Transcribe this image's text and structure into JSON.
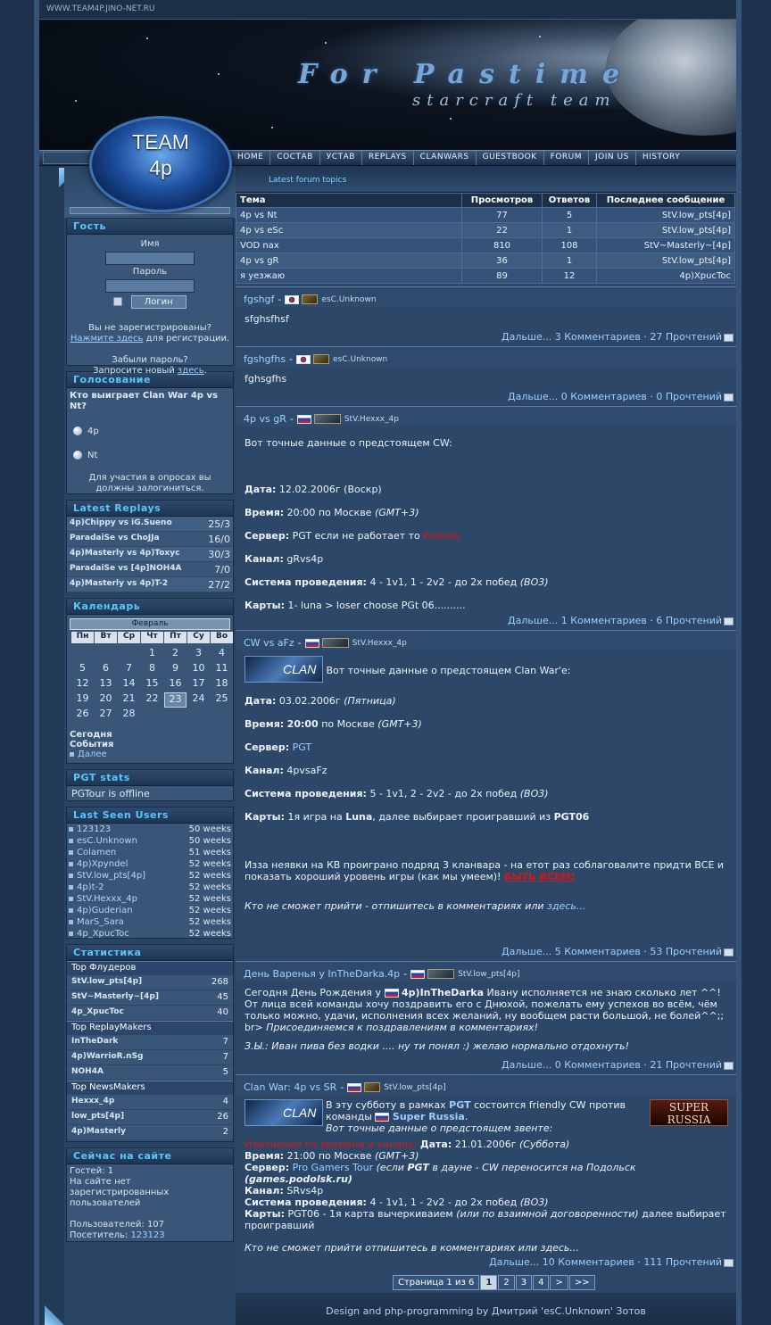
{
  "topbar_url": "WWW.TEAM4P.JINO-NET.RU",
  "header": {
    "title": "For Pastime",
    "subtitle": "starcraft team",
    "logo_line1": "TEAM",
    "logo_line2": "4p"
  },
  "nav": [
    "HOME",
    "СОСТАВ",
    "УСТАВ",
    "REPLAYS",
    "CLANWARS",
    "GUESTBOOK",
    "FORUM",
    "JOIN US",
    "HISTORY"
  ],
  "guest": {
    "title": "Гость",
    "name_label": "Имя",
    "password_label": "Пароль",
    "login_button": "Логин",
    "not_registered": "Вы не зарегистрированы?",
    "register_link": "Нажмите здесь",
    "register_suffix": "для регистрации.",
    "forgot": "Забыли пароль?",
    "request_prefix": "Запросите новый",
    "request_link": "здесь",
    "request_suffix": "."
  },
  "poll": {
    "title": "Голосование",
    "question": "Кто выиграет Clan War 4p vs Nt?",
    "options": [
      "4p",
      "Nt"
    ],
    "note": "Для участия в опросах вы должны залогиниться."
  },
  "replays": {
    "title": "Latest Replays",
    "items": [
      {
        "name": "4p)Chippy vs iG.Sueno",
        "score": "25/3"
      },
      {
        "name": "ParadaiSe vs ChoJJa",
        "score": "16/0"
      },
      {
        "name": "4p)Masterly vs 4p)Toxyc",
        "score": "30/3"
      },
      {
        "name": "ParadaiSe vs [4p]NOH4A",
        "score": "7/0"
      },
      {
        "name": "4p)Masterly vs 4p)T-2",
        "score": "27/2"
      }
    ]
  },
  "calendar": {
    "title": "Календарь",
    "month": "Февраль",
    "weekdays": [
      "Пн",
      "Вт",
      "Ср",
      "Чт",
      "Пт",
      "Су",
      "Во"
    ],
    "days": [
      "",
      "",
      "",
      "1",
      "2",
      "3",
      "4",
      "5",
      "6",
      "7",
      "8",
      "9",
      "10",
      "11",
      "12",
      "13",
      "14",
      "15",
      "16",
      "17",
      "18",
      "19",
      "20",
      "21",
      "22",
      "23",
      "24",
      "25",
      "26",
      "27",
      "28",
      "",
      "",
      "",
      ""
    ],
    "today": "23",
    "today_label": "Сегодня",
    "events_label": "События",
    "more_link": "Далее"
  },
  "pgt": {
    "title": "PGT stats",
    "status": "PGTour is offline"
  },
  "last_seen": {
    "title": "Last Seen Users",
    "items": [
      {
        "user": "123123",
        "ago": "50 weeks"
      },
      {
        "user": "esC.Unknown",
        "ago": "50 weeks"
      },
      {
        "user": "Colamen",
        "ago": "51 weeks"
      },
      {
        "user": "4p)Xpyndel",
        "ago": "52 weeks"
      },
      {
        "user": "StV.low_pts[4p]",
        "ago": "52 weeks"
      },
      {
        "user": "4p)t-2",
        "ago": "52 weeks"
      },
      {
        "user": "StV.Hexxx_4p",
        "ago": "52 weeks"
      },
      {
        "user": "4p)Guderian",
        "ago": "52 weeks"
      },
      {
        "user": "MarS_Sara",
        "ago": "52 weeks"
      },
      {
        "user": "4p_XpucToc",
        "ago": "52 weeks"
      }
    ]
  },
  "stats": {
    "title": "Статистика",
    "flooders_title": "Top Флудеров",
    "flooders": [
      {
        "name": "StV.low_pts[4p]",
        "value": "268"
      },
      {
        "name": "StV~Masterly~[4p]",
        "value": "45"
      },
      {
        "name": "4p_XpucToc",
        "value": "40"
      }
    ],
    "replaymakers_title": "Top ReplayMakers",
    "replaymakers": [
      {
        "name": "InTheDark",
        "value": "7"
      },
      {
        "name": "4p)WarrioR.nSg",
        "value": "7"
      },
      {
        "name": "NOH4A",
        "value": "5"
      }
    ],
    "newsmakers_title": "Top NewsMakers",
    "newsmakers": [
      {
        "name": "Hexxx_4p",
        "value": "4"
      },
      {
        "name": "low_pts[4p]",
        "value": "26"
      },
      {
        "name": "4p)Masterly",
        "value": "2"
      }
    ]
  },
  "online": {
    "title": "Сейчас на сайте",
    "guests": "Гостей: 1",
    "members": "На сайте нет зарегистрированных пользователей",
    "users": "Пользователей: 107",
    "visitor_prefix": "Посетитель:",
    "visitor_link": "123123"
  },
  "forum": {
    "title": "Latest forum topics",
    "headers": [
      "Тема",
      "Просмотров",
      "Ответов",
      "Последнее сообщение"
    ],
    "rows": [
      {
        "topic": "4p vs Nt",
        "views": "77",
        "replies": "5",
        "last": "StV.low_pts[4p]"
      },
      {
        "topic": "4p vs eSc",
        "views": "22",
        "replies": "1",
        "last": "StV.low_pts[4p]"
      },
      {
        "topic": "VOD nax",
        "views": "810",
        "replies": "108",
        "last": "StV~Masterly~[4p]"
      },
      {
        "topic": "4p vs gR",
        "views": "36",
        "replies": "1",
        "last": "StV.low_pts[4p]"
      },
      {
        "topic": "я уезжаю",
        "views": "89",
        "replies": "12",
        "last": "4p)XpucToc"
      }
    ]
  },
  "news": [
    {
      "title": "fgshgf",
      "author": "esC.Unknown",
      "body": "sfghsfhsf",
      "more": "Дальше...",
      "comments": "3 Комментариев",
      "reads": "27 Прочтений"
    },
    {
      "title": "fgshgfhs",
      "author": "esC.Unknown",
      "body": "fghsgfhs",
      "more": "Дальше...",
      "comments": "0 Комментариев",
      "reads": "0 Прочтений"
    },
    {
      "title": "4p vs gR",
      "author": "StV.Hexxx_4p",
      "intro": "Вот точные данные о предстоящем CW:",
      "date_label": "Дата:",
      "date": "12.02.2006г (Воскр)",
      "time_label": "Время:",
      "time": "20:00 по Москве",
      "time_tz": "(GMT+3)",
      "server_label": "Сервер:",
      "server": "PGT",
      "server_alt_prefix": "если не работает то",
      "server_alt": "Podolsk",
      "channel_label": "Канал:",
      "channel": "gRvs4p",
      "system_label": "Система проведения:",
      "system": "4 - 1v1, 1 - 2v2 - до 2х побед",
      "system_bo": "(BO3)",
      "maps_label": "Карты:",
      "maps": "1- luna > loser choose PGt 06..........",
      "more": "Дальше...",
      "comments": "1 Комментариев",
      "reads": "6 Прочтений"
    },
    {
      "title": "CW vs aFz",
      "author": "StV.Hexxx_4p",
      "clan_img": "CLAN",
      "intro": "Вот точные данные о предстоящем Clan War'e:",
      "date_label": "Дата:",
      "date": "03.02.2006г",
      "date_day": "(Пятница)",
      "time_label": "Время:",
      "time": "20:00",
      "time_rest": "по Москве",
      "time_tz": "(GMT+3)",
      "server_label": "Сервер:",
      "server": "PGT",
      "channel_label": "Канал:",
      "channel": "4pvsaFz",
      "system_label": "Система проведения:",
      "system": "5 - 1v1, 2 - 2v2 - до 2х побед",
      "system_bo": "(BO3)",
      "maps_label": "Карты:",
      "maps_prefix": "1я игра на",
      "maps_map": "Luna",
      "maps_mid": ", далее выбирает проигравший из",
      "maps_pool": "PGT06",
      "note": "Изза неявки на КВ проиграно подряд 3 кланвара - на етот раз соблаговалите придти ВСЕ и показать хороший уровень игры (как мы умеем)!",
      "note_call": "БЫТЬ ВСЕМ!",
      "footer_note": "Кто не сможет прийти - отпишитесь в комментариях или",
      "footer_link": "здесь...",
      "more": "Дальше...",
      "comments": "5 Комментариев",
      "reads": "53 Прочтений"
    },
    {
      "title": "День Варенья у InTheDarka.4p",
      "author": "StV.low_pts[4p]",
      "p1_prefix": "Сегодня День Рождения у",
      "p1_name": "4p)InTheDarka",
      "p1_rest": "Ивану исполняется не знаю сколько лет ^^! От лица всей команды хочу поздравить его с Днюхой, пожелать ему успехов во всём, чём только можно, удачи, исполнения всех желаний, ну вообщем расти большой, не болей^^;; br>",
      "p1_italic": "Присоединяемся к поздравлениям в комментариях!",
      "p2": "З.Ы.: Иван пива без водки .... ну ти понял :) желаю нормально отдохнуть!",
      "more": "Дальше...",
      "comments": "0 Комментариев",
      "reads": "21 Прочтений"
    },
    {
      "title": "Clan War: 4p vs SR",
      "author": "StV.low_pts[4p]",
      "clan_img": "CLAN",
      "sr_img": "SUPER RUSSIA",
      "intro_prefix": "В эту субботу в рамках",
      "intro_pgt": "PGT",
      "intro_mid": "состоится friendly CW против команды",
      "intro_team": "Super Russia",
      "intro_italic": "Вот точные данные о предстоящем звенте:",
      "red_note": "Изменения по времени и каналу:",
      "date_label": "Дата:",
      "date": "21.01.2006г",
      "date_day": "(Суббота)",
      "time_label": "Время:",
      "time": "21:00 по Москве",
      "time_tz": "(GMT+3)",
      "server_label": "Сервер:",
      "server": "Pro Gamers Tour",
      "server_note_1": "(если",
      "server_note_pgt": "PGT",
      "server_note_2": "в дауне - CW переносится на Подольск",
      "server_note_site": "(games.podolsk.ru)",
      "channel_label": "Канал:",
      "channel": "SRvs4p",
      "system_label": "Система проведения:",
      "system": "4 - 1v1, 1 - 2v2 - до 2х побед",
      "system_bo": "(BO3)",
      "maps_label": "Карты:",
      "maps": "PGT06 - 1я карта вычеркиваием",
      "maps_italic": "(или по взаимной договоренности)",
      "maps_rest": "далее выбирает проигравший",
      "footer_note": "Кто не сможет прийти отпишитесь в комментариях или здесь...",
      "more": "Дальше...",
      "comments": "10 Комментариев",
      "reads": "111 Прочтений"
    }
  ],
  "pager": {
    "label": "Страница 1 из 6",
    "pages": [
      "1",
      "2",
      "3",
      "4",
      ">",
      ">>"
    ],
    "current": "1"
  },
  "footer": "Design and php-programming by Дмитрий 'esC.Unknown' Зотов"
}
